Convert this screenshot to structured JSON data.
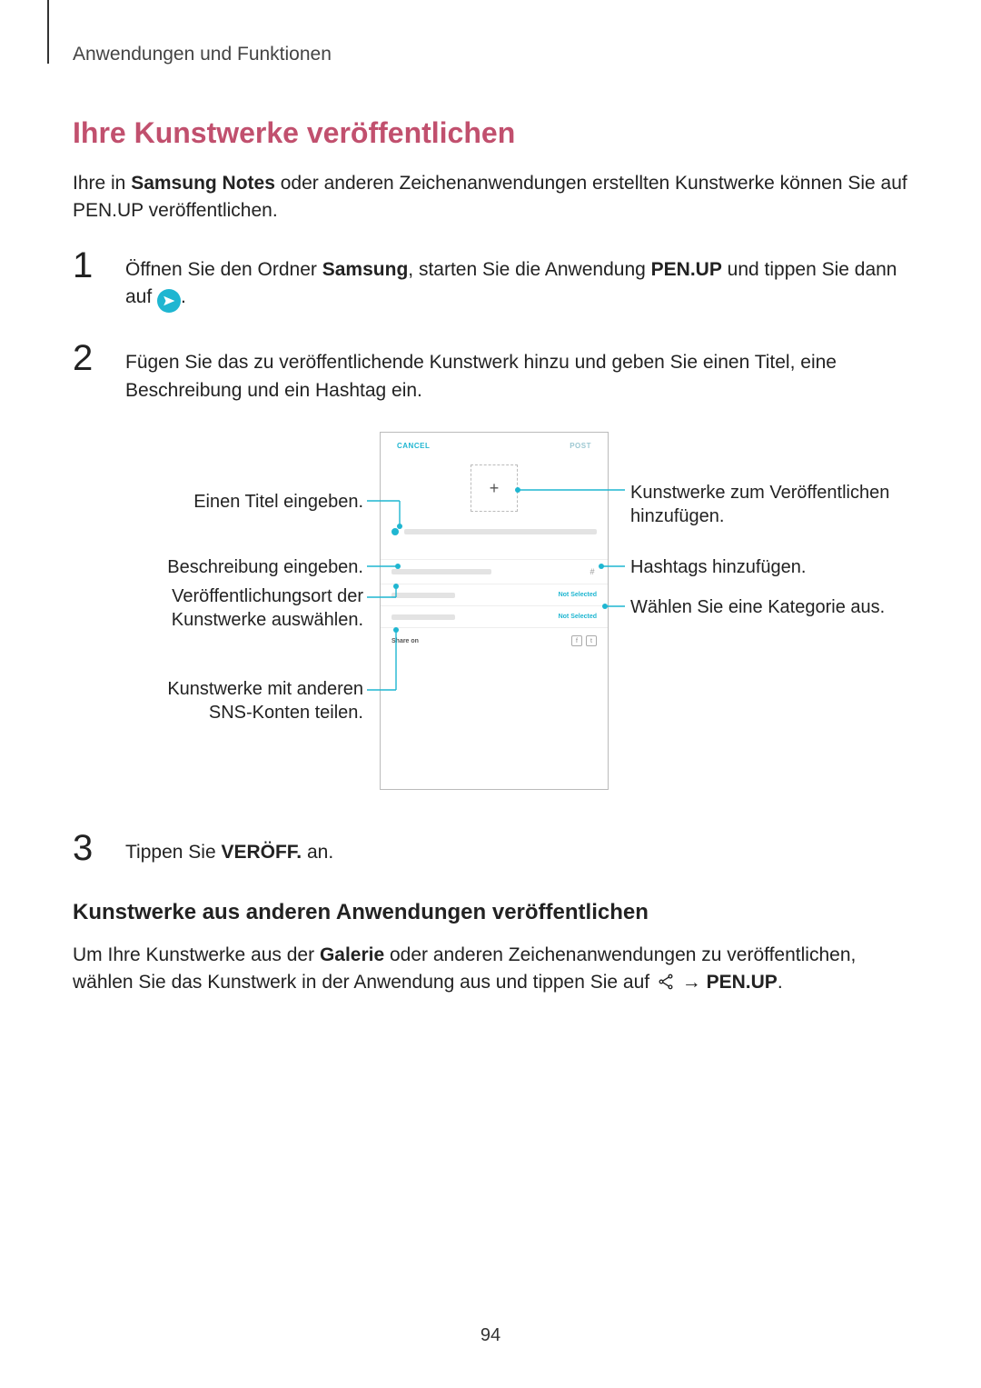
{
  "breadcrumb": "Anwendungen und Funktionen",
  "heading": "Ihre Kunstwerke veröffentlichen",
  "intro_pre": "Ihre in ",
  "intro_bold": "Samsung Notes",
  "intro_post": " oder anderen Zeichenanwendungen erstellten Kunstwerke können Sie auf PEN.UP veröffentlichen.",
  "step1_pre": "Öffnen Sie den Ordner ",
  "step1_bold1": "Samsung",
  "step1_mid": ", starten Sie die Anwendung ",
  "step1_bold2": "PEN.UP",
  "step1_post": " und tippen Sie dann auf ",
  "step1_period": ".",
  "step2": "Fügen Sie das zu veröffentlichende Kunstwerk hinzu und geben Sie einen Titel, eine Beschreibung und ein Hashtag ein.",
  "step3_pre": "Tippen Sie ",
  "step3_bold": "VERÖFF.",
  "step3_post": " an.",
  "callouts": {
    "left1": "Einen Titel eingeben.",
    "left2": "Beschreibung eingeben.",
    "left3a": "Veröffentlichungsort der",
    "left3b": "Kunstwerke auswählen.",
    "left4a": "Kunstwerke mit anderen",
    "left4b": "SNS-Konten teilen.",
    "right1a": "Kunstwerke zum Veröffentlichen",
    "right1b": "hinzufügen.",
    "right2": "Hashtags hinzufügen.",
    "right3": "Wählen Sie eine Kategorie aus."
  },
  "phone": {
    "cancel": "CANCEL",
    "post": "POST",
    "plus": "+",
    "not_selected": "Not Selected",
    "share_on": "Share on"
  },
  "subheading": "Kunstwerke aus anderen Anwendungen veröffentlichen",
  "para2_pre": "Um Ihre Kunstwerke aus der ",
  "para2_bold1": "Galerie",
  "para2_mid": " oder anderen Zeichenanwendungen zu veröffentlichen, wählen Sie das Kunstwerk in der Anwendung aus und tippen Sie auf ",
  "para2_arrow": " → ",
  "para2_bold2": "PEN.UP",
  "para2_period": ".",
  "page_number": "94"
}
